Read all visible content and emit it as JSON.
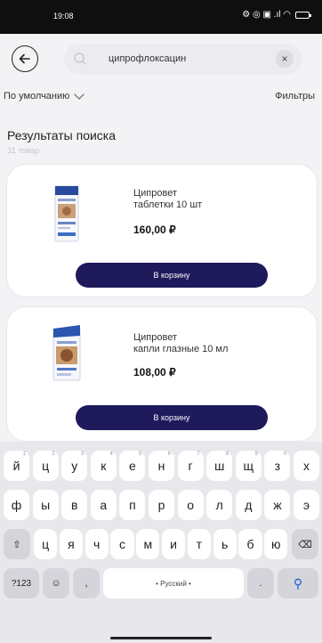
{
  "status_bar": {
    "time": "19:08",
    "icons_text": "⚙ ◎ ▣ .ıl ◠"
  },
  "search": {
    "value": "ципрофлоксацин",
    "clear_label": "×"
  },
  "sort": {
    "label": "По умолчанию",
    "filters_label": "Фильтры"
  },
  "results": {
    "title": "Результаты поиска",
    "count": "31 товар"
  },
  "products": [
    {
      "name_line1": "Ципровет",
      "name_line2": "таблетки 10 шт",
      "price": "160,00 ₽",
      "button": "В корзину",
      "icon": "tablets-box-image"
    },
    {
      "name_line1": "Ципровет",
      "name_line2": "капли глазные 10 мл",
      "price": "108,00 ₽",
      "button": "В корзину",
      "icon": "eye-drops-box-image"
    }
  ],
  "keyboard": {
    "row1": [
      "й",
      "ц",
      "у",
      "к",
      "е",
      "н",
      "г",
      "ш",
      "щ",
      "з",
      "х"
    ],
    "row1_hints": [
      "1",
      "2",
      "3",
      "4",
      "5",
      "6",
      "7",
      "8",
      "9",
      "0",
      ""
    ],
    "row2": [
      "ф",
      "ы",
      "в",
      "а",
      "п",
      "р",
      "о",
      "л",
      "д",
      "ж",
      "э"
    ],
    "row3": [
      "ц",
      "я",
      "ч",
      "с",
      "м",
      "и",
      "т",
      "ь",
      "б",
      "ю"
    ],
    "shift": "⇧",
    "backspace": "⌫",
    "symbols": "?123",
    "emoji": "☺",
    "comma": ",",
    "space": "• Русский •",
    "period": ".",
    "enter": "⚲",
    "colors": {
      "accent": "#1e1a5c",
      "enter": "#1a5bd6"
    }
  }
}
